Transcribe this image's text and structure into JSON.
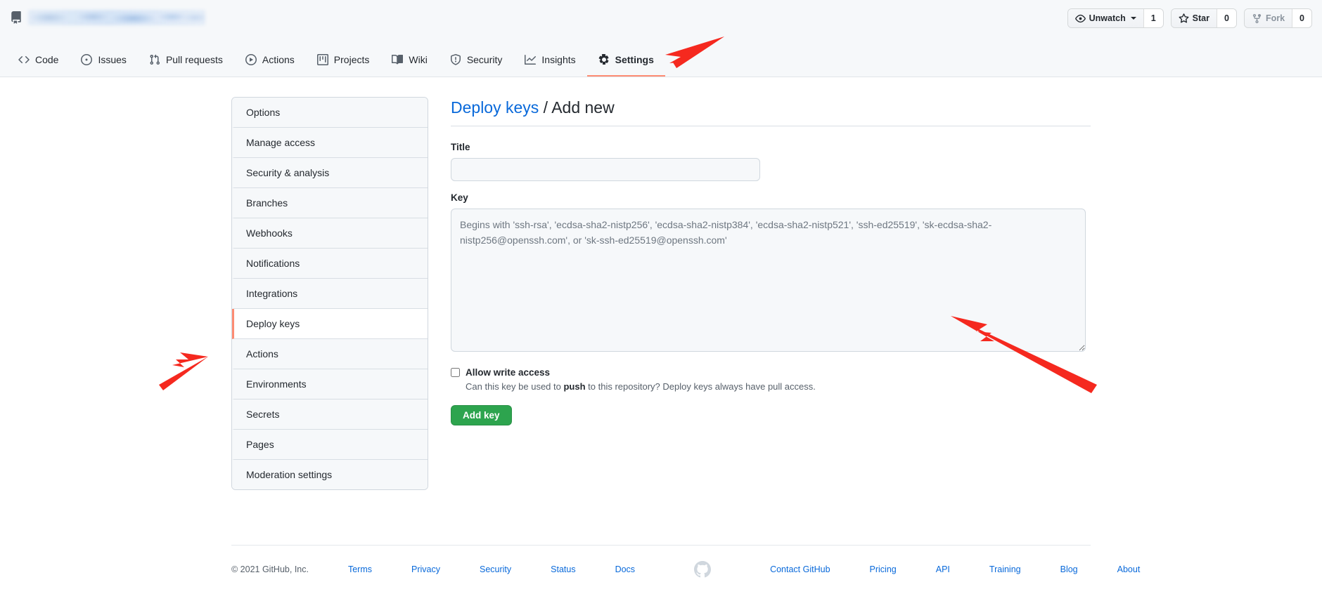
{
  "header": {
    "repo_icon": "repo-icon",
    "repo_name_redacted": "",
    "actions": [
      {
        "name": "unwatch",
        "icon": "eye-icon",
        "label": "Unwatch",
        "count": "1",
        "has_caret": true,
        "muted": false
      },
      {
        "name": "star",
        "icon": "star-icon",
        "label": "Star",
        "count": "0",
        "has_caret": false,
        "muted": false
      },
      {
        "name": "fork",
        "icon": "fork-icon",
        "label": "Fork",
        "count": "0",
        "has_caret": false,
        "muted": true
      }
    ],
    "nav": [
      {
        "label": "Code",
        "icon": "code-icon",
        "active": false
      },
      {
        "label": "Issues",
        "icon": "issue-opened-icon",
        "active": false
      },
      {
        "label": "Pull requests",
        "icon": "git-pull-request-icon",
        "active": false
      },
      {
        "label": "Actions",
        "icon": "play-icon",
        "active": false
      },
      {
        "label": "Projects",
        "icon": "project-board-icon",
        "active": false
      },
      {
        "label": "Wiki",
        "icon": "book-icon",
        "active": false
      },
      {
        "label": "Security",
        "icon": "shield-icon",
        "active": false
      },
      {
        "label": "Insights",
        "icon": "graph-icon",
        "active": false
      },
      {
        "label": "Settings",
        "icon": "gear-icon",
        "active": true
      }
    ]
  },
  "sidebar": {
    "items": [
      {
        "label": "Options",
        "selected": false
      },
      {
        "label": "Manage access",
        "selected": false
      },
      {
        "label": "Security & analysis",
        "selected": false
      },
      {
        "label": "Branches",
        "selected": false
      },
      {
        "label": "Webhooks",
        "selected": false
      },
      {
        "label": "Notifications",
        "selected": false
      },
      {
        "label": "Integrations",
        "selected": false
      },
      {
        "label": "Deploy keys",
        "selected": true
      },
      {
        "label": "Actions",
        "selected": false
      },
      {
        "label": "Environments",
        "selected": false
      },
      {
        "label": "Secrets",
        "selected": false
      },
      {
        "label": "Pages",
        "selected": false
      },
      {
        "label": "Moderation settings",
        "selected": false
      }
    ]
  },
  "main": {
    "breadcrumb_link": "Deploy keys",
    "breadcrumb_sep": " / ",
    "breadcrumb_current": "Add new",
    "title_label": "Title",
    "title_value": "",
    "title_placeholder": "",
    "key_label": "Key",
    "key_value": "",
    "key_placeholder": "Begins with 'ssh-rsa', 'ecdsa-sha2-nistp256', 'ecdsa-sha2-nistp384', 'ecdsa-sha2-nistp521', 'ssh-ed25519', 'sk-ecdsa-sha2-nistp256@openssh.com', or 'sk-ssh-ed25519@openssh.com'",
    "allow_write_label": "Allow write access",
    "allow_write_checked": false,
    "allow_write_note_pre": "Can this key be used to ",
    "allow_write_note_bold": "push",
    "allow_write_note_post": " to this repository? Deploy keys always have pull access.",
    "submit_label": "Add key"
  },
  "footer": {
    "copyright": "© 2021 GitHub, Inc.",
    "left_links": [
      "Terms",
      "Privacy",
      "Security",
      "Status",
      "Docs"
    ],
    "mark_icon": "github-mark-icon",
    "right_links": [
      "Contact GitHub",
      "Pricing",
      "API",
      "Training",
      "Blog",
      "About"
    ]
  },
  "annotations": {
    "arrow_color": "#f5291f",
    "arrows": [
      {
        "name": "arrow-to-settings-tab",
        "points_to": "Settings"
      },
      {
        "name": "arrow-to-deploy-keys",
        "points_to": "Deploy keys"
      },
      {
        "name": "arrow-to-key-textarea",
        "points_to": "Key"
      }
    ]
  },
  "colors": {
    "accent": "#0969da",
    "success": "#2da44e",
    "active_underline": "#fd8c73",
    "header_bg": "#f6f8fa",
    "border": "#d0d7de",
    "annotation_red": "#f5291f"
  }
}
